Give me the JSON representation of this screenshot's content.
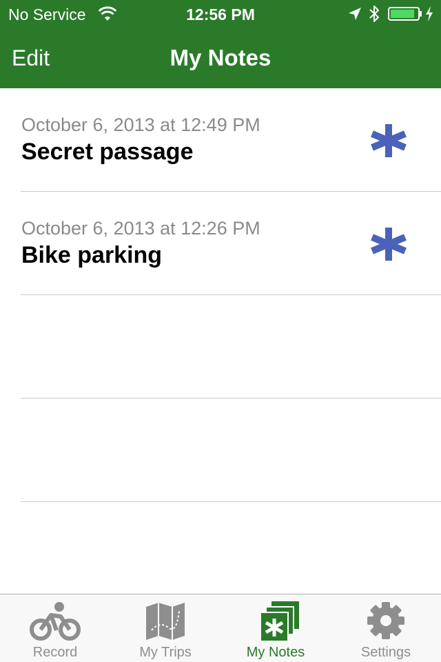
{
  "status_bar": {
    "carrier": "No Service",
    "time": "12:56 PM",
    "battery_color": "#4cd964"
  },
  "nav": {
    "edit_label": "Edit",
    "title": "My Notes",
    "background_color": "#2a7a2a"
  },
  "notes": [
    {
      "date": "October 6, 2013 at 12:49 PM",
      "title": "Secret passage",
      "icon": "asterisk-icon"
    },
    {
      "date": "October 6, 2013 at 12:26 PM",
      "title": "Bike parking",
      "icon": "asterisk-icon"
    }
  ],
  "note_icon_color": "#4a62b8",
  "tabs": [
    {
      "label": "Record",
      "icon": "bicycle-icon",
      "active": false
    },
    {
      "label": "My Trips",
      "icon": "map-icon",
      "active": false
    },
    {
      "label": "My Notes",
      "icon": "notes-icon",
      "active": true
    },
    {
      "label": "Settings",
      "icon": "gear-icon",
      "active": false
    }
  ],
  "active_tab_color": "#2a7a2a"
}
